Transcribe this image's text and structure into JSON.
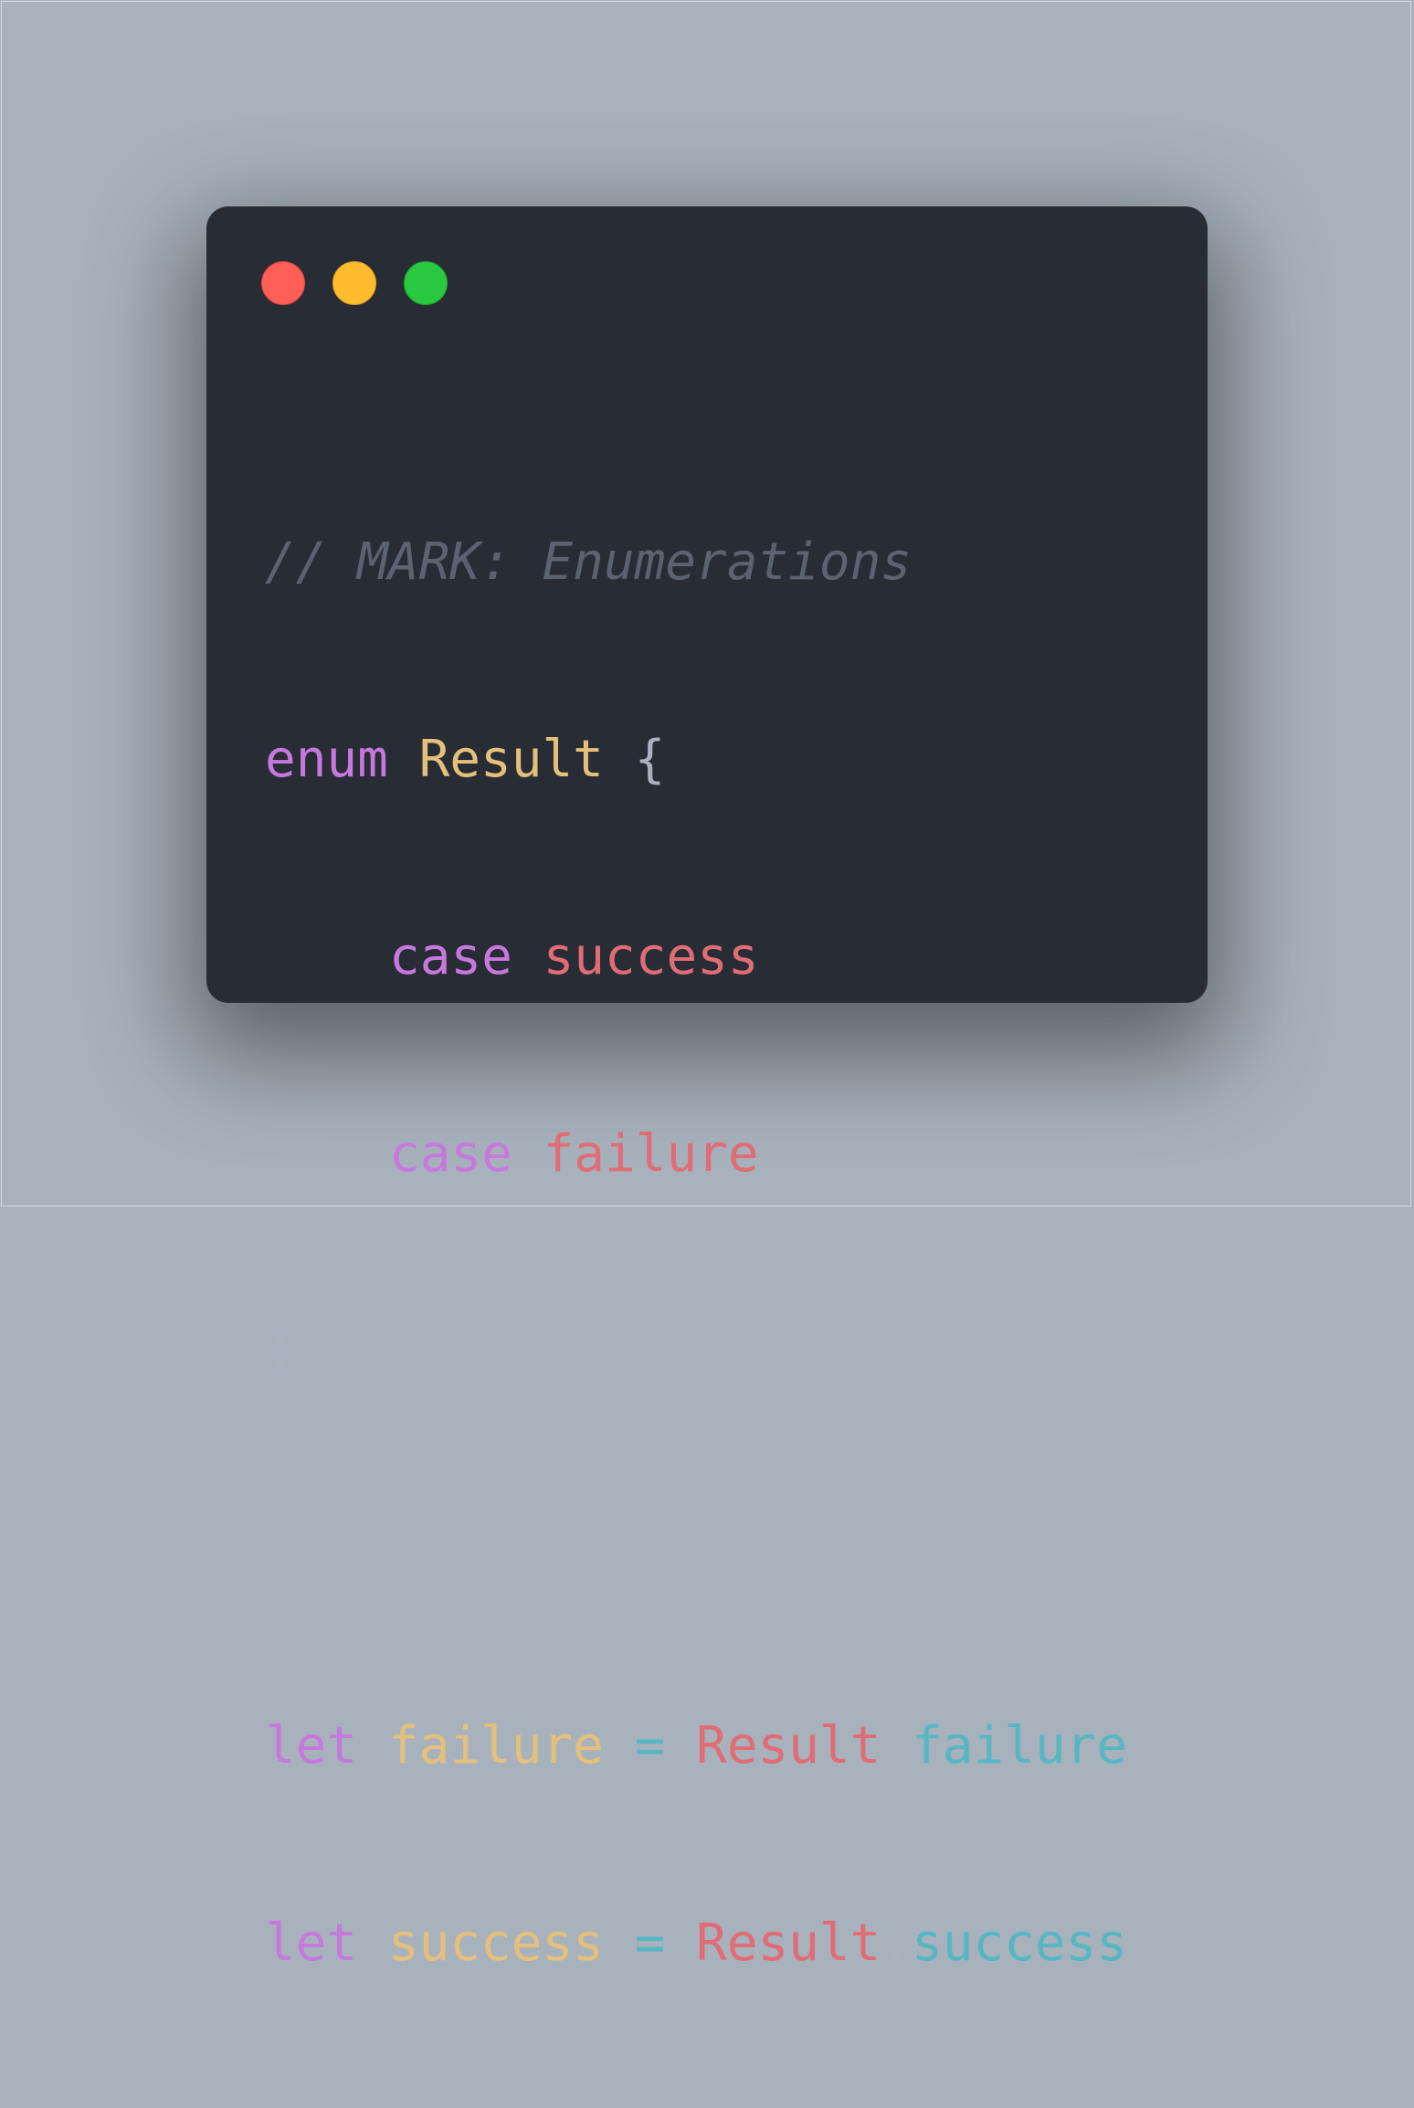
{
  "colors": {
    "background": "#a8b2bd",
    "editor_bg": "#282c35",
    "keyword": "#c678dd",
    "type": "#e5c07b",
    "enum_case": "#e06c75",
    "property": "#56b6c2",
    "comment": "#5c6370",
    "punctuation": "#abb2bf",
    "close": "#ff5f57",
    "minimize": "#febc2e",
    "zoom": "#28c840"
  },
  "window_controls": [
    "close",
    "minimize",
    "zoom"
  ],
  "code": {
    "comment": "// MARK: Enumerations",
    "enum_keyword": "enum",
    "enum_name": "Result",
    "open_brace": "{",
    "case_keyword": "case",
    "case_success": "success",
    "case_failure": "failure",
    "close_brace": "}",
    "let_keyword": "let",
    "var_failure": "failure",
    "var_success": "success",
    "equals": "=",
    "type_ref": "Result",
    "dot": ".",
    "member_failure": "failure",
    "member_success": "success"
  }
}
